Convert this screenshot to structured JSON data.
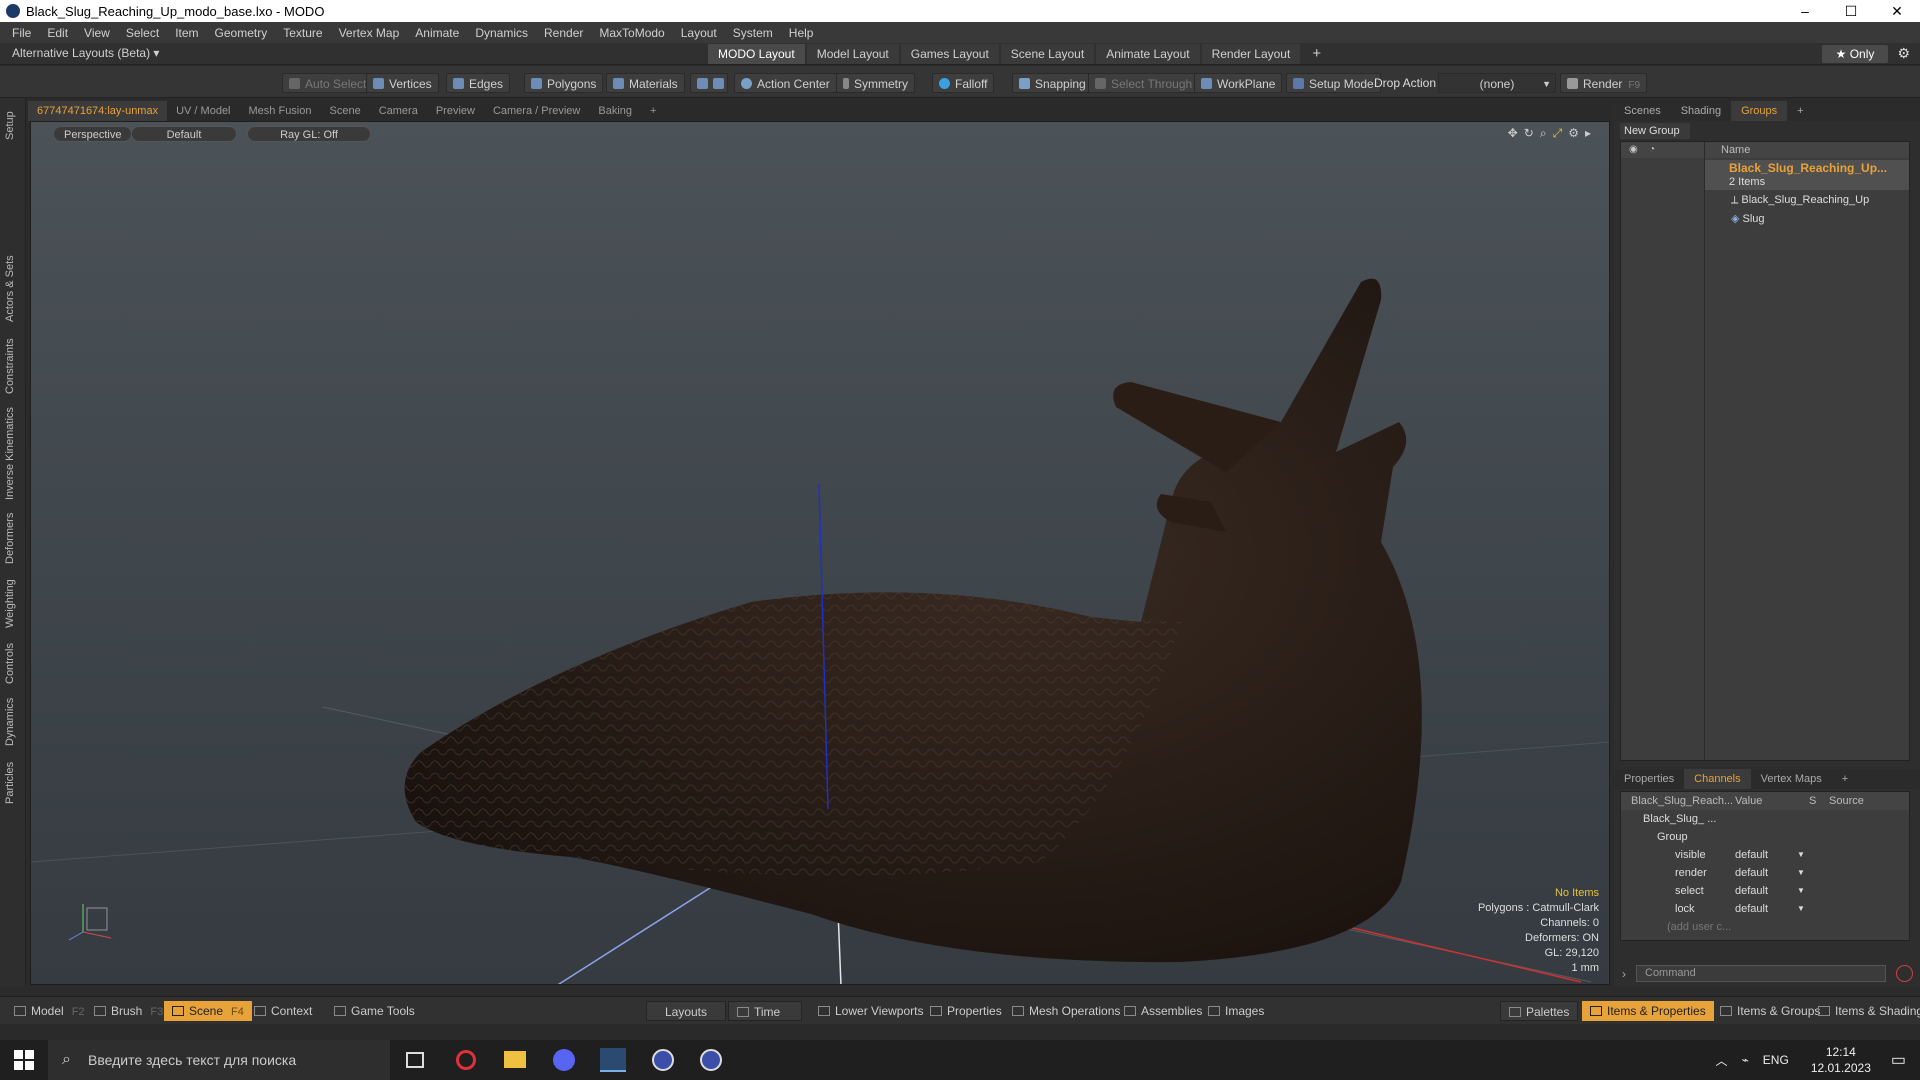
{
  "window": {
    "title": "Black_Slug_Reaching_Up_modo_base.lxo - MODO",
    "minimize": "–",
    "maximize": "☐",
    "close": "✕"
  },
  "menu": [
    "File",
    "Edit",
    "View",
    "Select",
    "Item",
    "Geometry",
    "Texture",
    "Vertex Map",
    "Animate",
    "Dynamics",
    "Render",
    "MaxToModo",
    "Layout",
    "System",
    "Help"
  ],
  "layout_bar": {
    "alt_layouts": "Alternative Layouts (Beta) ▾",
    "tabs": [
      "MODO Layout",
      "Model Layout",
      "Games Layout",
      "Scene Layout",
      "Animate Layout",
      "Render Layout"
    ],
    "active_tab": "MODO Layout",
    "add": "+",
    "only": "★ Only"
  },
  "toolbar": {
    "auto_select": "Auto Select",
    "vertices": "Vertices",
    "edges": "Edges",
    "polygons": "Polygons",
    "materials": "Materials",
    "action_center": "Action Center",
    "symmetry": "Symmetry",
    "falloff": "Falloff",
    "snapping": "Snapping",
    "select_through": "Select Through",
    "workplane": "WorkPlane",
    "setup_mode": "Setup Mode",
    "drop_action": "Drop Action",
    "drop_value": "(none)",
    "render": "Render",
    "render_key": "F9"
  },
  "left_tabs": [
    "Setup",
    "Actors & Sets",
    "Constraints",
    "Inverse Kinematics",
    "Deformers",
    "Weighting",
    "Controls",
    "Dynamics",
    "Particles"
  ],
  "viewport_tabs": [
    "67747471674:lay-unmax",
    "UV / Model",
    "Mesh Fusion",
    "Scene",
    "Camera",
    "Preview",
    "Camera / Preview",
    "Baking",
    "+"
  ],
  "viewport": {
    "view": "Perspective",
    "shading": "Default",
    "raygl": "Ray GL: Off",
    "stats": [
      "No Items",
      "Polygons : Catmull-Clark",
      "Channels: 0",
      "Deformers: ON",
      "GL: 29,120",
      "1 mm"
    ]
  },
  "right_top_tabs": [
    "Scenes",
    "Shading",
    "Groups",
    "+"
  ],
  "groups": {
    "new_group": "New Group",
    "name_header": "Name",
    "group_name": "Black_Slug_Reaching_Up...",
    "count": "2 Items",
    "items": [
      "Black_Slug_Reaching_Up",
      "Slug"
    ]
  },
  "right_bottom_tabs": [
    "Properties",
    "Channels",
    "Vertex Maps",
    "+"
  ],
  "channels": {
    "headers": [
      "Black_Slug_Reach...",
      "Value",
      "S",
      "Source"
    ],
    "root": "Black_Slug_ ...",
    "group": "Group",
    "rows": [
      {
        "name": "visible",
        "value": "default"
      },
      {
        "name": "render",
        "value": "default"
      },
      {
        "name": "select",
        "value": "default"
      },
      {
        "name": "lock",
        "value": "default"
      }
    ],
    "add_user": "(add user c..."
  },
  "command_placeholder": "Command",
  "bottom": {
    "model": "Model",
    "model_key": "F2",
    "brush": "Brush",
    "brush_key": "F3",
    "scene": "Scene",
    "scene_key": "F4",
    "context": "Context",
    "game_tools": "Game Tools",
    "layouts": "Layouts",
    "time": "Time",
    "lower_viewports": "Lower Viewports",
    "properties": "Properties",
    "mesh_operations": "Mesh Operations",
    "assemblies": "Assemblies",
    "images": "Images",
    "palettes": "Palettes",
    "items_props": "Items & Properties",
    "items_groups": "Items & Groups",
    "items_shading": "Items & Shading"
  },
  "taskbar": {
    "search": "Введите здесь текст для поиска",
    "lang": "ENG",
    "time": "12:14",
    "date": "12.01.2023"
  }
}
